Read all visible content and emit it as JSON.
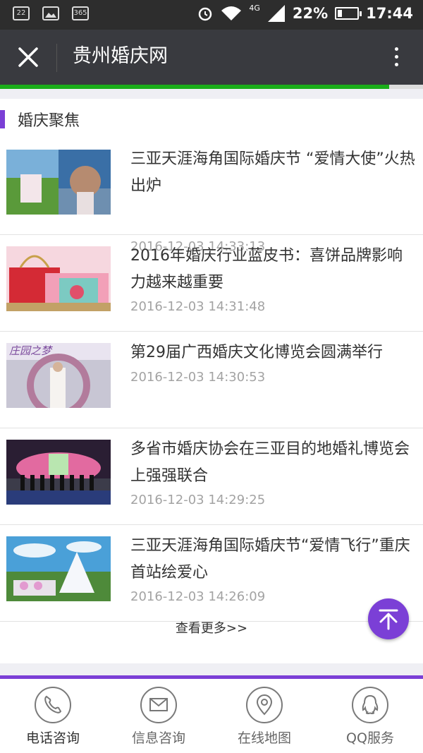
{
  "status_bar": {
    "notif_1": "22",
    "notif_3": "365",
    "network": "4G",
    "battery": "22%",
    "time": "17:44",
    "battery_level": 0.22
  },
  "titlebar": {
    "title": "贵州婚庆网"
  },
  "progress": 0.92,
  "section": {
    "title": "婚庆聚焦"
  },
  "articles": [
    {
      "title": "三亚天涯海角国际婚庆节 “爱情大使”火热出炉",
      "time": "2016-12-03 14:33:13"
    },
    {
      "title": "2016年婚庆行业蓝皮书：喜饼品牌影响力越来越重要",
      "time": "2016-12-03 14:31:48"
    },
    {
      "title": "第29届广西婚庆文化博览会圆满举行",
      "time": "2016-12-03 14:30:53"
    },
    {
      "title": "多省市婚庆协会在三亚目的地婚礼博览会上强强联合",
      "time": "2016-12-03 14:29:25"
    },
    {
      "title": "三亚天涯海角国际婚庆节“爱情飞行”重庆首站绘爱心",
      "time": "2016-12-03 14:26:09"
    }
  ],
  "thumb_text": {
    "item3": "庄园之梦"
  },
  "more_link": "查看更多>>",
  "bottom_nav": [
    {
      "label": "电话咨询",
      "icon": "phone-icon"
    },
    {
      "label": "信息咨询",
      "icon": "mail-icon"
    },
    {
      "label": "在线地图",
      "icon": "map-pin-icon"
    },
    {
      "label": "QQ服务",
      "icon": "qq-icon"
    }
  ],
  "colors": {
    "accent": "#7b3fd6",
    "progress": "#1aad19",
    "titlebar": "#393a3f"
  }
}
